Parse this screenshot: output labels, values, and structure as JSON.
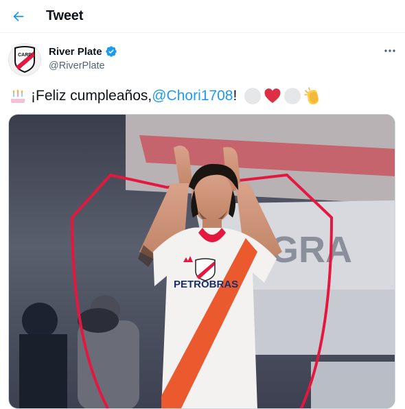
{
  "header": {
    "title": "Tweet",
    "back_icon": "arrow-left-icon"
  },
  "author": {
    "display_name": "River Plate",
    "handle": "@RiverPlate",
    "verified": true,
    "verified_color": "#1d9bf0",
    "avatar_icon": "river-plate-crest-icon"
  },
  "tweet": {
    "text_prefix": "¡Feliz cumpleaños, ",
    "mention": "@Chori1708",
    "text_suffix": "!",
    "leading_emoji": "birthday-cake",
    "trailing_emojis": [
      "white-circle",
      "red-heart",
      "white-circle",
      "clapping-hands"
    ]
  },
  "media": {
    "shirt_sponsor": "PETROBRAS",
    "banner_text": "GRA",
    "frame_color": "#e4173e"
  },
  "colors": {
    "accent": "#1d9bf0",
    "text": "#0f1419",
    "muted": "#536471",
    "brand_red": "#e4173e"
  }
}
